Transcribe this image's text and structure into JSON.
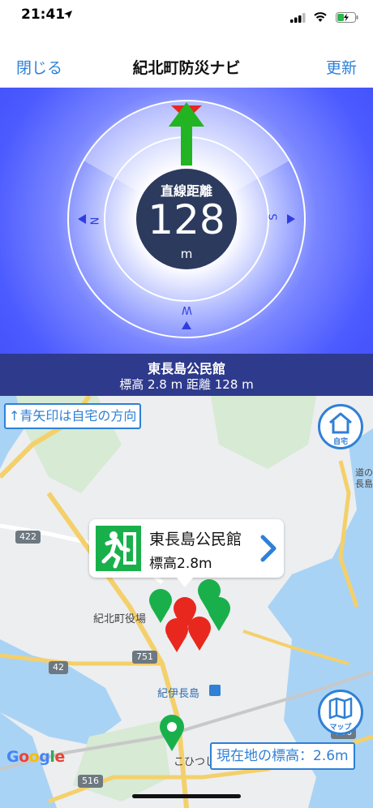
{
  "status_bar": {
    "time": "21:41",
    "icons": [
      "location-arrow-icon",
      "signal-icon",
      "wifi-icon",
      "battery-charging-icon"
    ]
  },
  "nav": {
    "close_label": "閉じる",
    "title": "紀北町防災ナビ",
    "refresh_label": "更新"
  },
  "compass": {
    "distance_label": "直線距離",
    "distance_value": "128",
    "distance_unit": "m",
    "cardinals": {
      "north": "N",
      "south": "S",
      "west": "W"
    },
    "heading_arrow_color": "#22b422",
    "marker_color": "#e8281e"
  },
  "destination": {
    "name": "東長島公民館",
    "info": "標高 2.8 m   距離 128 m"
  },
  "map": {
    "hint": "↑青矢印は自宅の方向",
    "home_button_label": "自宅",
    "map_button_label": "マップ",
    "callout": {
      "name": "東長島公民館",
      "elevation": "標高2.8m"
    },
    "current_elevation": "現在地の標高：2.6m",
    "attribution": "Google",
    "labels": {
      "town_hall": "紀北町役場",
      "station": "紀伊長島",
      "area": "こひつじ",
      "road_edge_1": "道の",
      "road_edge_2": "長島"
    },
    "road_numbers": [
      "422",
      "751",
      "42",
      "516",
      "766"
    ]
  }
}
